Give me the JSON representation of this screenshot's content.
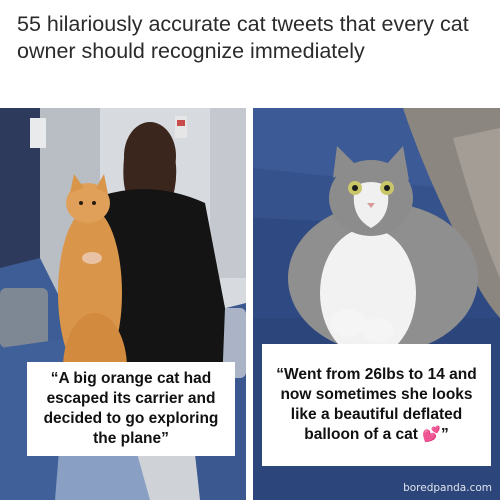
{
  "headline": "55 hilariously accurate cat tweets that every cat owner should recognize immediately",
  "tweets": [
    {
      "caption": "“A big orange cat had escaped its carrier and decided to go exploring the plane”"
    },
    {
      "caption": "“Went from 26lbs to 14 and now sometimes she looks like a beautiful deflated balloon of a cat",
      "emoji": "💕",
      "caption_end": "”"
    }
  ],
  "watermark": "boredpanda.com",
  "colors": {
    "headline": "#2b2b2b",
    "seat_blue": "#3d5a8f",
    "sofa_blue": "#2f4a82",
    "orange_cat": "#d9954a",
    "grey_cat": "#8f8f8f"
  }
}
